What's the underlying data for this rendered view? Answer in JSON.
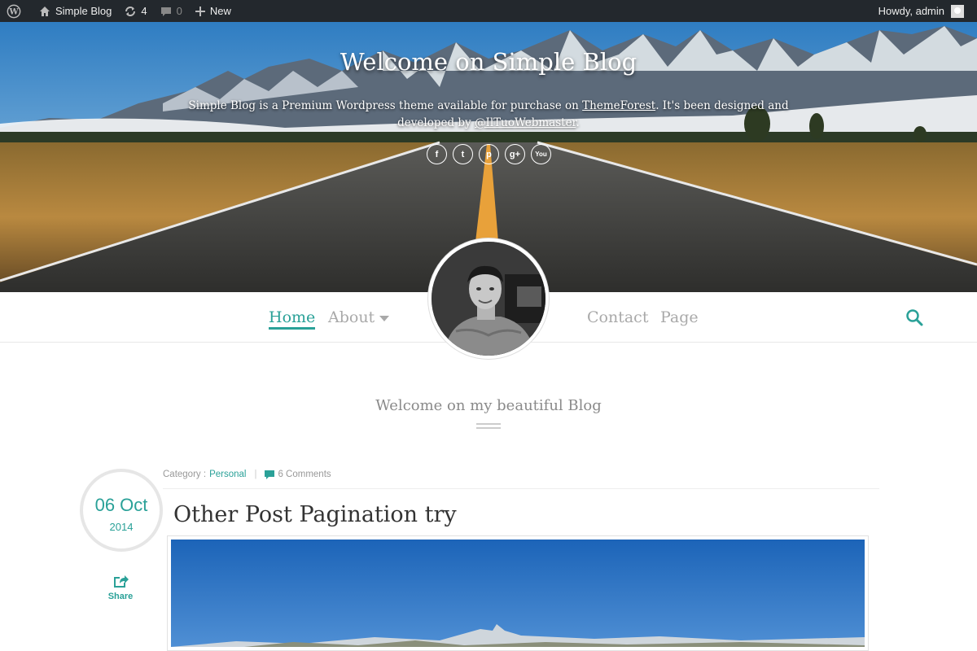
{
  "adminbar": {
    "site_name": "Simple Blog",
    "updates_count": "4",
    "comments_count": "0",
    "new_label": "New",
    "howdy": "Howdy, admin"
  },
  "hero": {
    "title": "Welcome on Simple Blog",
    "desc_part1": "Simple Blog is a Premium Wordpress theme available for purchase on ",
    "desc_link1": "ThemeForest",
    "desc_part2": ". It's been designed and developed by ",
    "desc_link2": "@IlTuoWebmaster",
    "desc_part3": ".",
    "social": [
      {
        "icon": "facebook-icon",
        "glyph": "f"
      },
      {
        "icon": "twitter-icon",
        "glyph": "t"
      },
      {
        "icon": "pinterest-icon",
        "glyph": "p"
      },
      {
        "icon": "google-plus-icon",
        "glyph": "g+"
      },
      {
        "icon": "youtube-icon",
        "glyph": "You"
      }
    ]
  },
  "nav": {
    "home": "Home",
    "about": "About",
    "contact": "Contact",
    "page": "Page"
  },
  "section": {
    "title": "Welcome on my beautiful Blog"
  },
  "post": {
    "category_label": "Category :",
    "category_value": "Personal",
    "comments": "6 Comments",
    "date_day": "06 Oct",
    "date_year": "2014",
    "share_label": "Share",
    "title": "Other Post Pagination try"
  },
  "colors": {
    "accent": "#2aa198",
    "nav_inactive": "#a9a9a9",
    "adminbar_bg": "#23282d"
  }
}
